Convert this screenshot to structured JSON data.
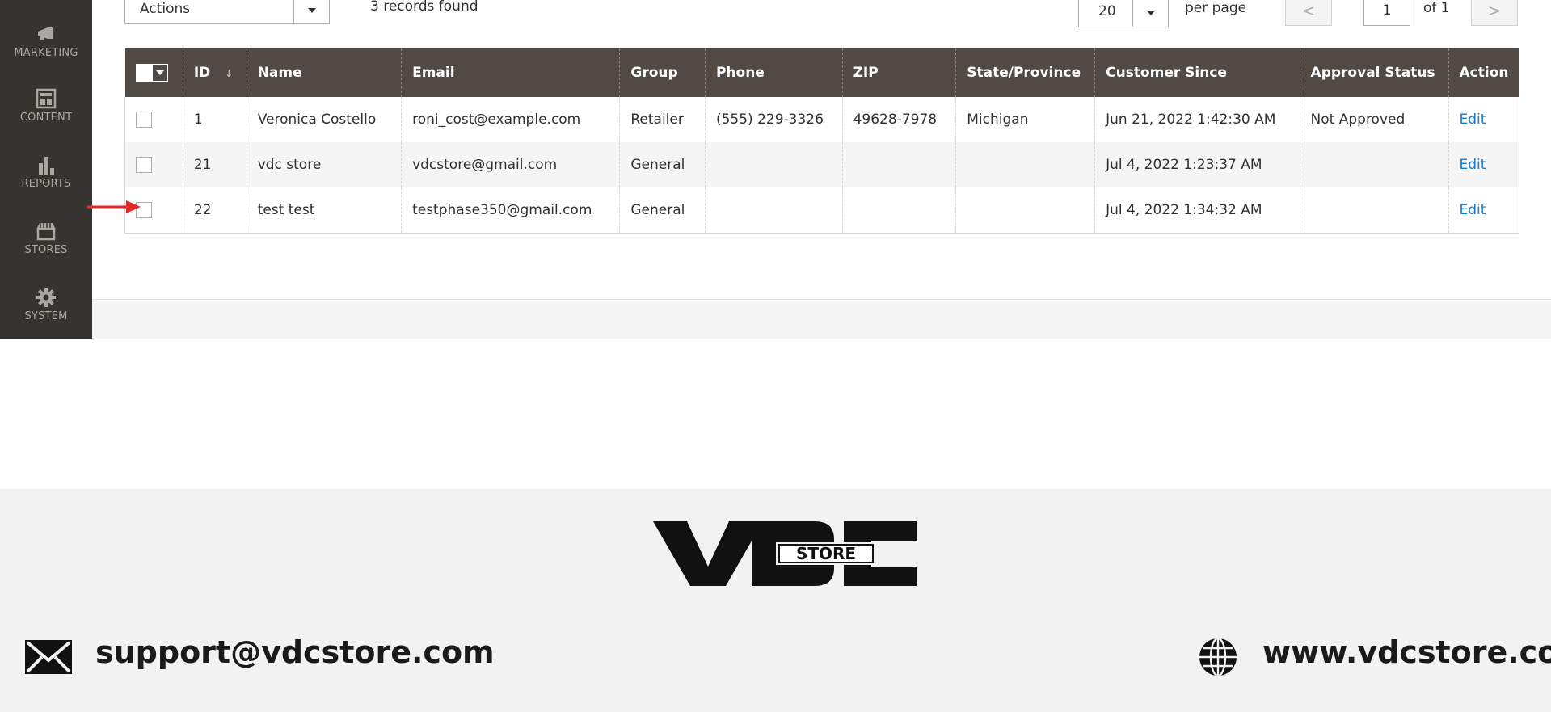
{
  "sidebar": {
    "items": [
      {
        "label": "MARKETING",
        "icon": "megaphone-icon"
      },
      {
        "label": "CONTENT",
        "icon": "layout-icon"
      },
      {
        "label": "REPORTS",
        "icon": "bar-chart-icon"
      },
      {
        "label": "STORES",
        "icon": "storefront-icon"
      },
      {
        "label": "SYSTEM",
        "icon": "gear-icon"
      }
    ]
  },
  "toolbar": {
    "actions_label": "Actions",
    "records_found": "3 records found",
    "per_page_value": "20",
    "per_page_label": "per page",
    "page_number": "1",
    "page_of": "of 1",
    "prev_label": "<",
    "next_label": ">"
  },
  "grid": {
    "columns": [
      "ID",
      "Name",
      "Email",
      "Group",
      "Phone",
      "ZIP",
      "State/Province",
      "Customer Since",
      "Approval Status",
      "Action"
    ],
    "sort_indicator": "↓",
    "rows": [
      {
        "id": "1",
        "name": "Veronica Costello",
        "email": "roni_cost@example.com",
        "group": "Retailer",
        "phone": "(555) 229-3326",
        "zip": "49628-7978",
        "state": "Michigan",
        "since": "Jun 21, 2022 1:42:30 AM",
        "approval": "Not Approved",
        "action": "Edit"
      },
      {
        "id": "21",
        "name": "vdc store",
        "email": "vdcstore@gmail.com",
        "group": "General",
        "phone": "",
        "zip": "",
        "state": "",
        "since": "Jul 4, 2022 1:23:37 AM",
        "approval": "",
        "action": "Edit"
      },
      {
        "id": "22",
        "name": "test test",
        "email": "testphase350@gmail.com",
        "group": "General",
        "phone": "",
        "zip": "",
        "state": "",
        "since": "Jul 4, 2022 1:34:32 AM",
        "approval": "",
        "action": "Edit"
      }
    ]
  },
  "promo": {
    "logo_text": "VDC",
    "logo_badge": "STORE",
    "email": "support@vdcstore.com",
    "website": "www.vdcstore.com"
  },
  "colors": {
    "sidebar": "#373330",
    "header": "#514943",
    "link": "#1979c3",
    "arrow": "#e02b27"
  }
}
